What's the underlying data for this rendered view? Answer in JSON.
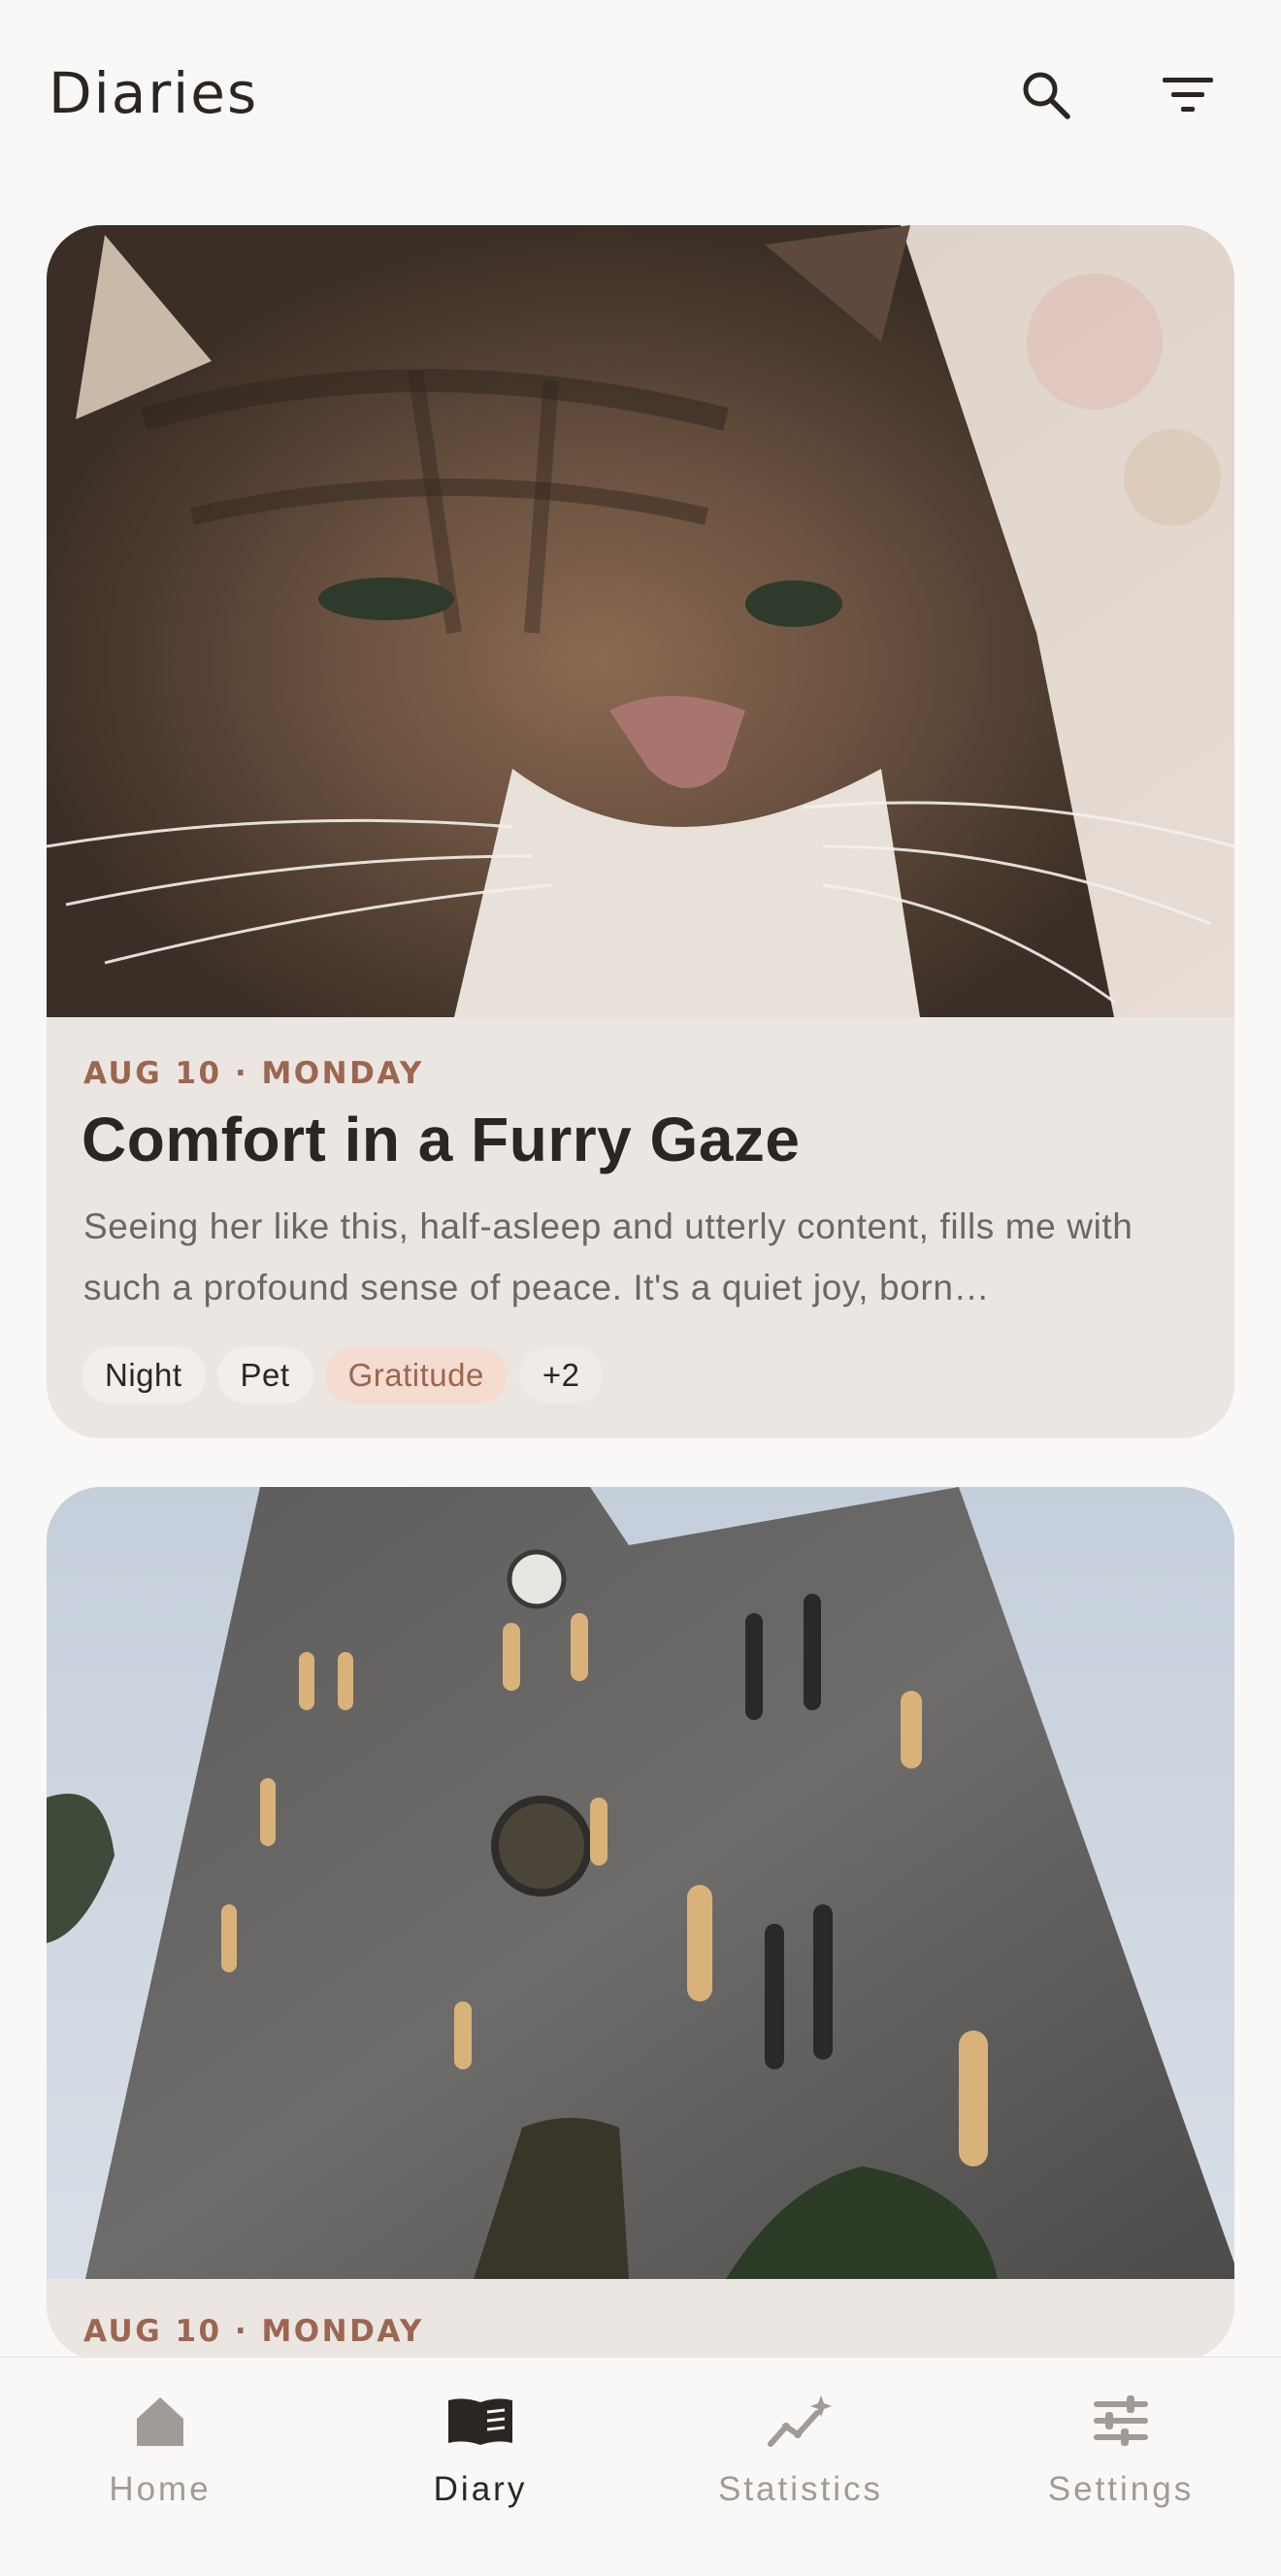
{
  "app_bar": {
    "title": "Diaries",
    "search_icon": "search-icon",
    "filter_icon": "filter-icon"
  },
  "entries": [
    {
      "date": "AUG 10 · MONDAY",
      "title": "Comfort in a Furry Gaze",
      "excerpt": "Seeing her like this, half-asleep and utterly content, fills me with such a profound sense of peace. It's a quiet joy, born…",
      "tags": [
        "Night",
        "Pet",
        "Gratitude"
      ],
      "more_tags": "+2",
      "image": "tabby-cat-closeup"
    },
    {
      "date": "AUG 10 · MONDAY",
      "image": "gothic-cathedral-facade"
    }
  ],
  "bottom_nav": {
    "items": [
      {
        "label": "Home",
        "icon": "home-icon"
      },
      {
        "label": "Diary",
        "icon": "book-icon"
      },
      {
        "label": "Statistics",
        "icon": "statistics-icon"
      },
      {
        "label": "Settings",
        "icon": "sliders-icon"
      }
    ],
    "active": "Diary"
  },
  "colors": {
    "background": "#f9f8f6",
    "card": "#ebe6e1",
    "accent": "#9c6650",
    "highlight_tag": "#f5dcd0",
    "inactive_nav": "#a09b97"
  }
}
